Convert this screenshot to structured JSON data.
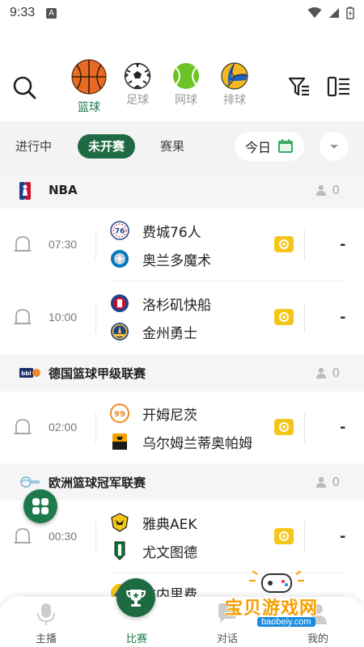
{
  "status_bar": {
    "time": "9:33",
    "notification_badge": "A"
  },
  "sports": [
    {
      "label": "篮球",
      "icon": "basketball-icon",
      "active": true
    },
    {
      "label": "足球",
      "icon": "soccer-ball-icon",
      "active": false
    },
    {
      "label": "网球",
      "icon": "tennis-ball-icon",
      "active": false
    },
    {
      "label": "排球",
      "icon": "volleyball-icon",
      "active": false
    }
  ],
  "tabs": {
    "in_progress": "进行中",
    "not_started": "未开赛",
    "results": "赛果",
    "today": "今日"
  },
  "leagues": [
    {
      "name": "NBA",
      "viewers": "0",
      "matches": [
        {
          "time": "07:30",
          "home": "费城76人",
          "away": "奥兰多魔术",
          "score": "-"
        },
        {
          "time": "10:00",
          "home": "洛杉矶快船",
          "away": "金州勇士",
          "score": "-"
        }
      ]
    },
    {
      "name": "德国篮球甲级联赛",
      "viewers": "0",
      "matches": [
        {
          "time": "02:00",
          "home": "开姆尼茨",
          "away": "乌尔姆兰蒂奥帕姆",
          "score": "-"
        }
      ]
    },
    {
      "name": "欧洲篮球冠军联赛",
      "viewers": "0",
      "matches": [
        {
          "time": "00:30",
          "home": "雅典AEK",
          "away": "尤文图德",
          "score": "-"
        },
        {
          "time": "",
          "home": "布内里费",
          "away": "",
          "score": ""
        }
      ]
    }
  ],
  "bottom_nav": [
    {
      "label": "主播",
      "icon": "microphone-icon"
    },
    {
      "label": "比赛",
      "icon": "trophy-icon"
    },
    {
      "label": "对话",
      "icon": "chat-icon"
    },
    {
      "label": "我的",
      "icon": "profile-icon"
    }
  ],
  "watermark": {
    "text": "宝贝游戏网",
    "url": "baobeiy.com"
  },
  "colors": {
    "brand_green": "#1e7a4b",
    "live_yellow": "#f5c518"
  }
}
